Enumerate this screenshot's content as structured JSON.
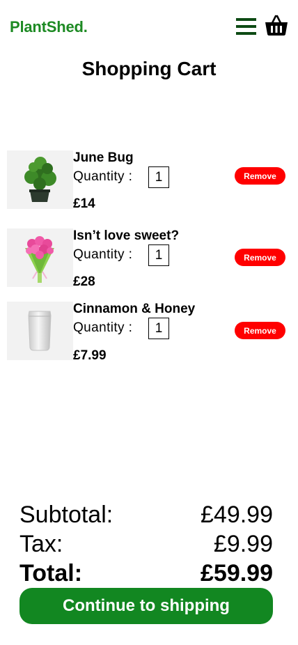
{
  "header": {
    "logo": "PlantShed.",
    "menu_icon": "hamburger-menu-icon",
    "cart_icon": "basket-icon"
  },
  "page_title": "Shopping Cart",
  "cart": {
    "quantity_label": "Quantity :",
    "remove_label": "Remove",
    "items": [
      {
        "name": "June Bug",
        "quantity": "1",
        "price": "£14",
        "image": "potted-bonsai-plant"
      },
      {
        "name": "Isn’t love sweet?",
        "quantity": "1",
        "price": "£28",
        "image": "pink-rose-bouquet"
      },
      {
        "name": "Cinnamon & Honey",
        "quantity": "1",
        "price": "£7.99",
        "image": "silver-pouch-bag"
      }
    ]
  },
  "summary": {
    "subtotal_label": "Subtotal:",
    "subtotal_value": "£49.99",
    "tax_label": "Tax:",
    "tax_value": "£9.99",
    "total_label": "Total:",
    "total_value": "£59.99"
  },
  "cta_label": "Continue to shipping",
  "colors": {
    "brand_green": "#1d8a23",
    "button_green": "#128721",
    "remove_red": "#ff0000"
  }
}
